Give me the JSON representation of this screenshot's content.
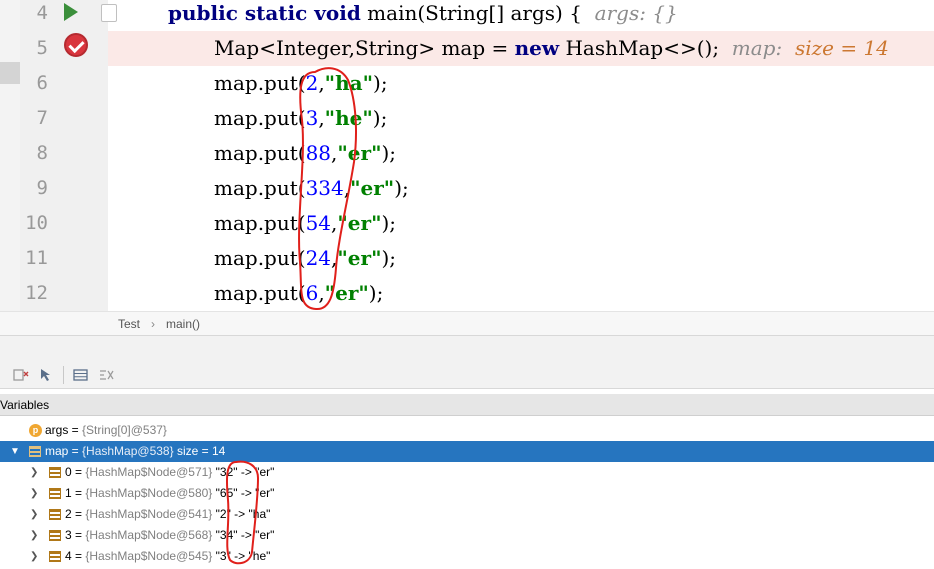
{
  "editor": {
    "lines": [
      {
        "num": "4",
        "kind": "main",
        "keyword1": "public static void",
        "text": " main(String[] args) {",
        "hint": "args: {}"
      },
      {
        "num": "5",
        "kind": "decl",
        "text_pre": "Map<Integer,String> map = ",
        "keyword": "new",
        "text_post": " HashMap<>();",
        "hint_label": "map:",
        "hint_value": "size = 14"
      },
      {
        "num": "6",
        "kind": "put",
        "key": "2",
        "val": "\"ha\""
      },
      {
        "num": "7",
        "kind": "put",
        "key": "3",
        "val": "\"he\""
      },
      {
        "num": "8",
        "kind": "put",
        "key": "88",
        "val": "\"er\""
      },
      {
        "num": "9",
        "kind": "put",
        "key": "334",
        "val": "\"er\""
      },
      {
        "num": "10",
        "kind": "put",
        "key": "54",
        "val": "\"er\""
      },
      {
        "num": "11",
        "kind": "put",
        "key": "24",
        "val": "\"er\""
      },
      {
        "num": "12",
        "kind": "put",
        "key": "6",
        "val": "\"er\""
      }
    ],
    "put_prefix": "map.put(",
    "put_comma": ",",
    "put_suffix": ");"
  },
  "breadcrumb": {
    "class_name": "Test",
    "separator": "›",
    "method": "main()"
  },
  "variables": {
    "header": "Variables",
    "rows": [
      {
        "icon": "p",
        "name": "args",
        "eq": " = ",
        "value": "{String[0]@537}",
        "expanded": null,
        "selected": false,
        "indent": 0
      },
      {
        "icon": "field",
        "name": "map",
        "eq": " = ",
        "value": "{HashMap@538}",
        "extra": "  size = 14",
        "expanded": true,
        "selected": true,
        "indent": 0
      },
      {
        "icon": "field",
        "name": "0",
        "eq": " = ",
        "value": "{HashMap$Node@571}",
        "entry": " \"32\" -> \"er\"",
        "expanded": false,
        "selected": false,
        "indent": 1
      },
      {
        "icon": "field",
        "name": "1",
        "eq": " = ",
        "value": "{HashMap$Node@580}",
        "entry": " \"65\" -> \"er\"",
        "expanded": false,
        "selected": false,
        "indent": 1
      },
      {
        "icon": "field",
        "name": "2",
        "eq": " = ",
        "value": "{HashMap$Node@541}",
        "entry": " \"2\" -> \"ha\"",
        "expanded": false,
        "selected": false,
        "indent": 1
      },
      {
        "icon": "field",
        "name": "3",
        "eq": " = ",
        "value": "{HashMap$Node@568}",
        "entry": " \"34\" -> \"er\"",
        "expanded": false,
        "selected": false,
        "indent": 1
      },
      {
        "icon": "field",
        "name": "4",
        "eq": " = ",
        "value": "{HashMap$Node@545}",
        "entry": " \"3\" -> \"he\"",
        "expanded": false,
        "selected": false,
        "indent": 1
      }
    ]
  },
  "colors": {
    "selection": "#2675bf",
    "keyword": "#000080",
    "number": "#0000ff",
    "string": "#008000",
    "annotation": "#e0201b",
    "exec_line": "#fbe9e7"
  },
  "icons": {
    "run": "run-arrow-icon",
    "breakpoint": "breakpoint-check-icon",
    "fold": "fold-icon"
  }
}
